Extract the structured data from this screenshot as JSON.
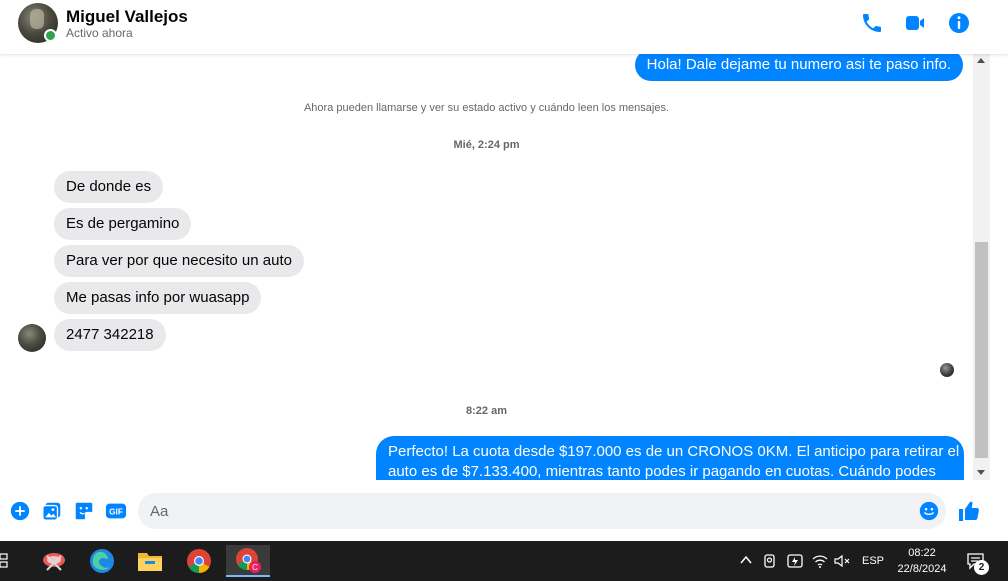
{
  "header": {
    "name": "Miguel Vallejos",
    "status": "Activo ahora"
  },
  "messages": {
    "out_1": "Hola! Dale dejame tu numero  asi te paso info.",
    "system_notice": "Ahora pueden llamarse y ver su estado activo y cuándo leen los mensajes.",
    "timestamp_1": "Mié, 2:24 pm",
    "in_1": "De donde es",
    "in_2": "Es de pergamino",
    "in_3": "Para ver por que necesito un auto",
    "in_4": "Me pasas info por wuasapp",
    "in_5": "2477 342218",
    "timestamp_2": "8:22 am",
    "out_2_line1": "Perfecto! La cuota desde $197.000 es de un CRONOS 0KM. El anticipo para retirar el",
    "out_2_line2": "auto es de $7.133.400, mientras tanto podes ir pagando en cuotas. Cuándo podes"
  },
  "composer": {
    "placeholder": "Aa"
  },
  "taskbar": {
    "language": "ESP",
    "time": "08:22",
    "date": "22/8/2024",
    "notification_count": "2"
  },
  "colors": {
    "accent": "#0084ff",
    "incoming_bubble": "#e9e9eb",
    "online": "#31a24c",
    "taskbar": "#1c1c1c"
  },
  "icons": [
    "phone-icon",
    "video-icon",
    "info-icon",
    "plus-icon",
    "photo-icon",
    "sticker-icon",
    "gif-icon",
    "emoji-icon",
    "like-icon"
  ]
}
